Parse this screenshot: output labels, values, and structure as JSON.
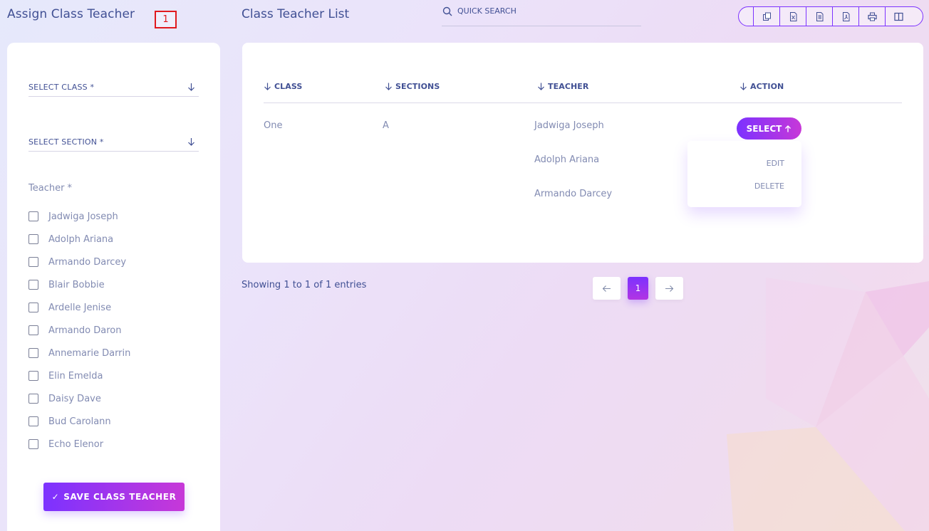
{
  "page": {
    "title": "Assign Class Teacher",
    "marker_label": "1",
    "list_title": "Class Teacher List"
  },
  "search": {
    "placeholder": "QUICK SEARCH"
  },
  "export_buttons": [
    "copy-icon",
    "excel-icon",
    "csv-icon",
    "pdf-icon",
    "print-icon",
    "columns-icon"
  ],
  "form": {
    "class_label": "SELECT CLASS *",
    "section_label": "SELECT SECTION *",
    "teacher_label": "Teacher *",
    "teachers": [
      "Jadwiga Joseph",
      "Adolph Ariana",
      "Armando Darcey",
      "Blair Bobbie",
      "Ardelle Jenise",
      "Armando Daron",
      "Annemarie Darrin",
      "Elin Emelda",
      "Daisy Dave",
      "Bud Carolann",
      "Echo Elenor"
    ],
    "save_label": "SAVE CLASS TEACHER"
  },
  "table": {
    "headers": [
      "CLASS",
      "SECTIONS",
      "TEACHER",
      "ACTION"
    ],
    "row": {
      "class": "One",
      "section": "A",
      "teachers": [
        "Jadwiga Joseph",
        "Adolph Ariana",
        "Armando Darcey"
      ]
    },
    "action_label": "SELECT",
    "menu": [
      "EDIT",
      "DELETE"
    ]
  },
  "footer": {
    "showing": "Showing 1 to 1 of 1 entries",
    "current_page": "1"
  },
  "colors": {
    "accent": "#7c32ff",
    "accent_end": "#c738d8",
    "text": "#415094",
    "muted": "#828bb2",
    "marker": "#e0191e"
  }
}
